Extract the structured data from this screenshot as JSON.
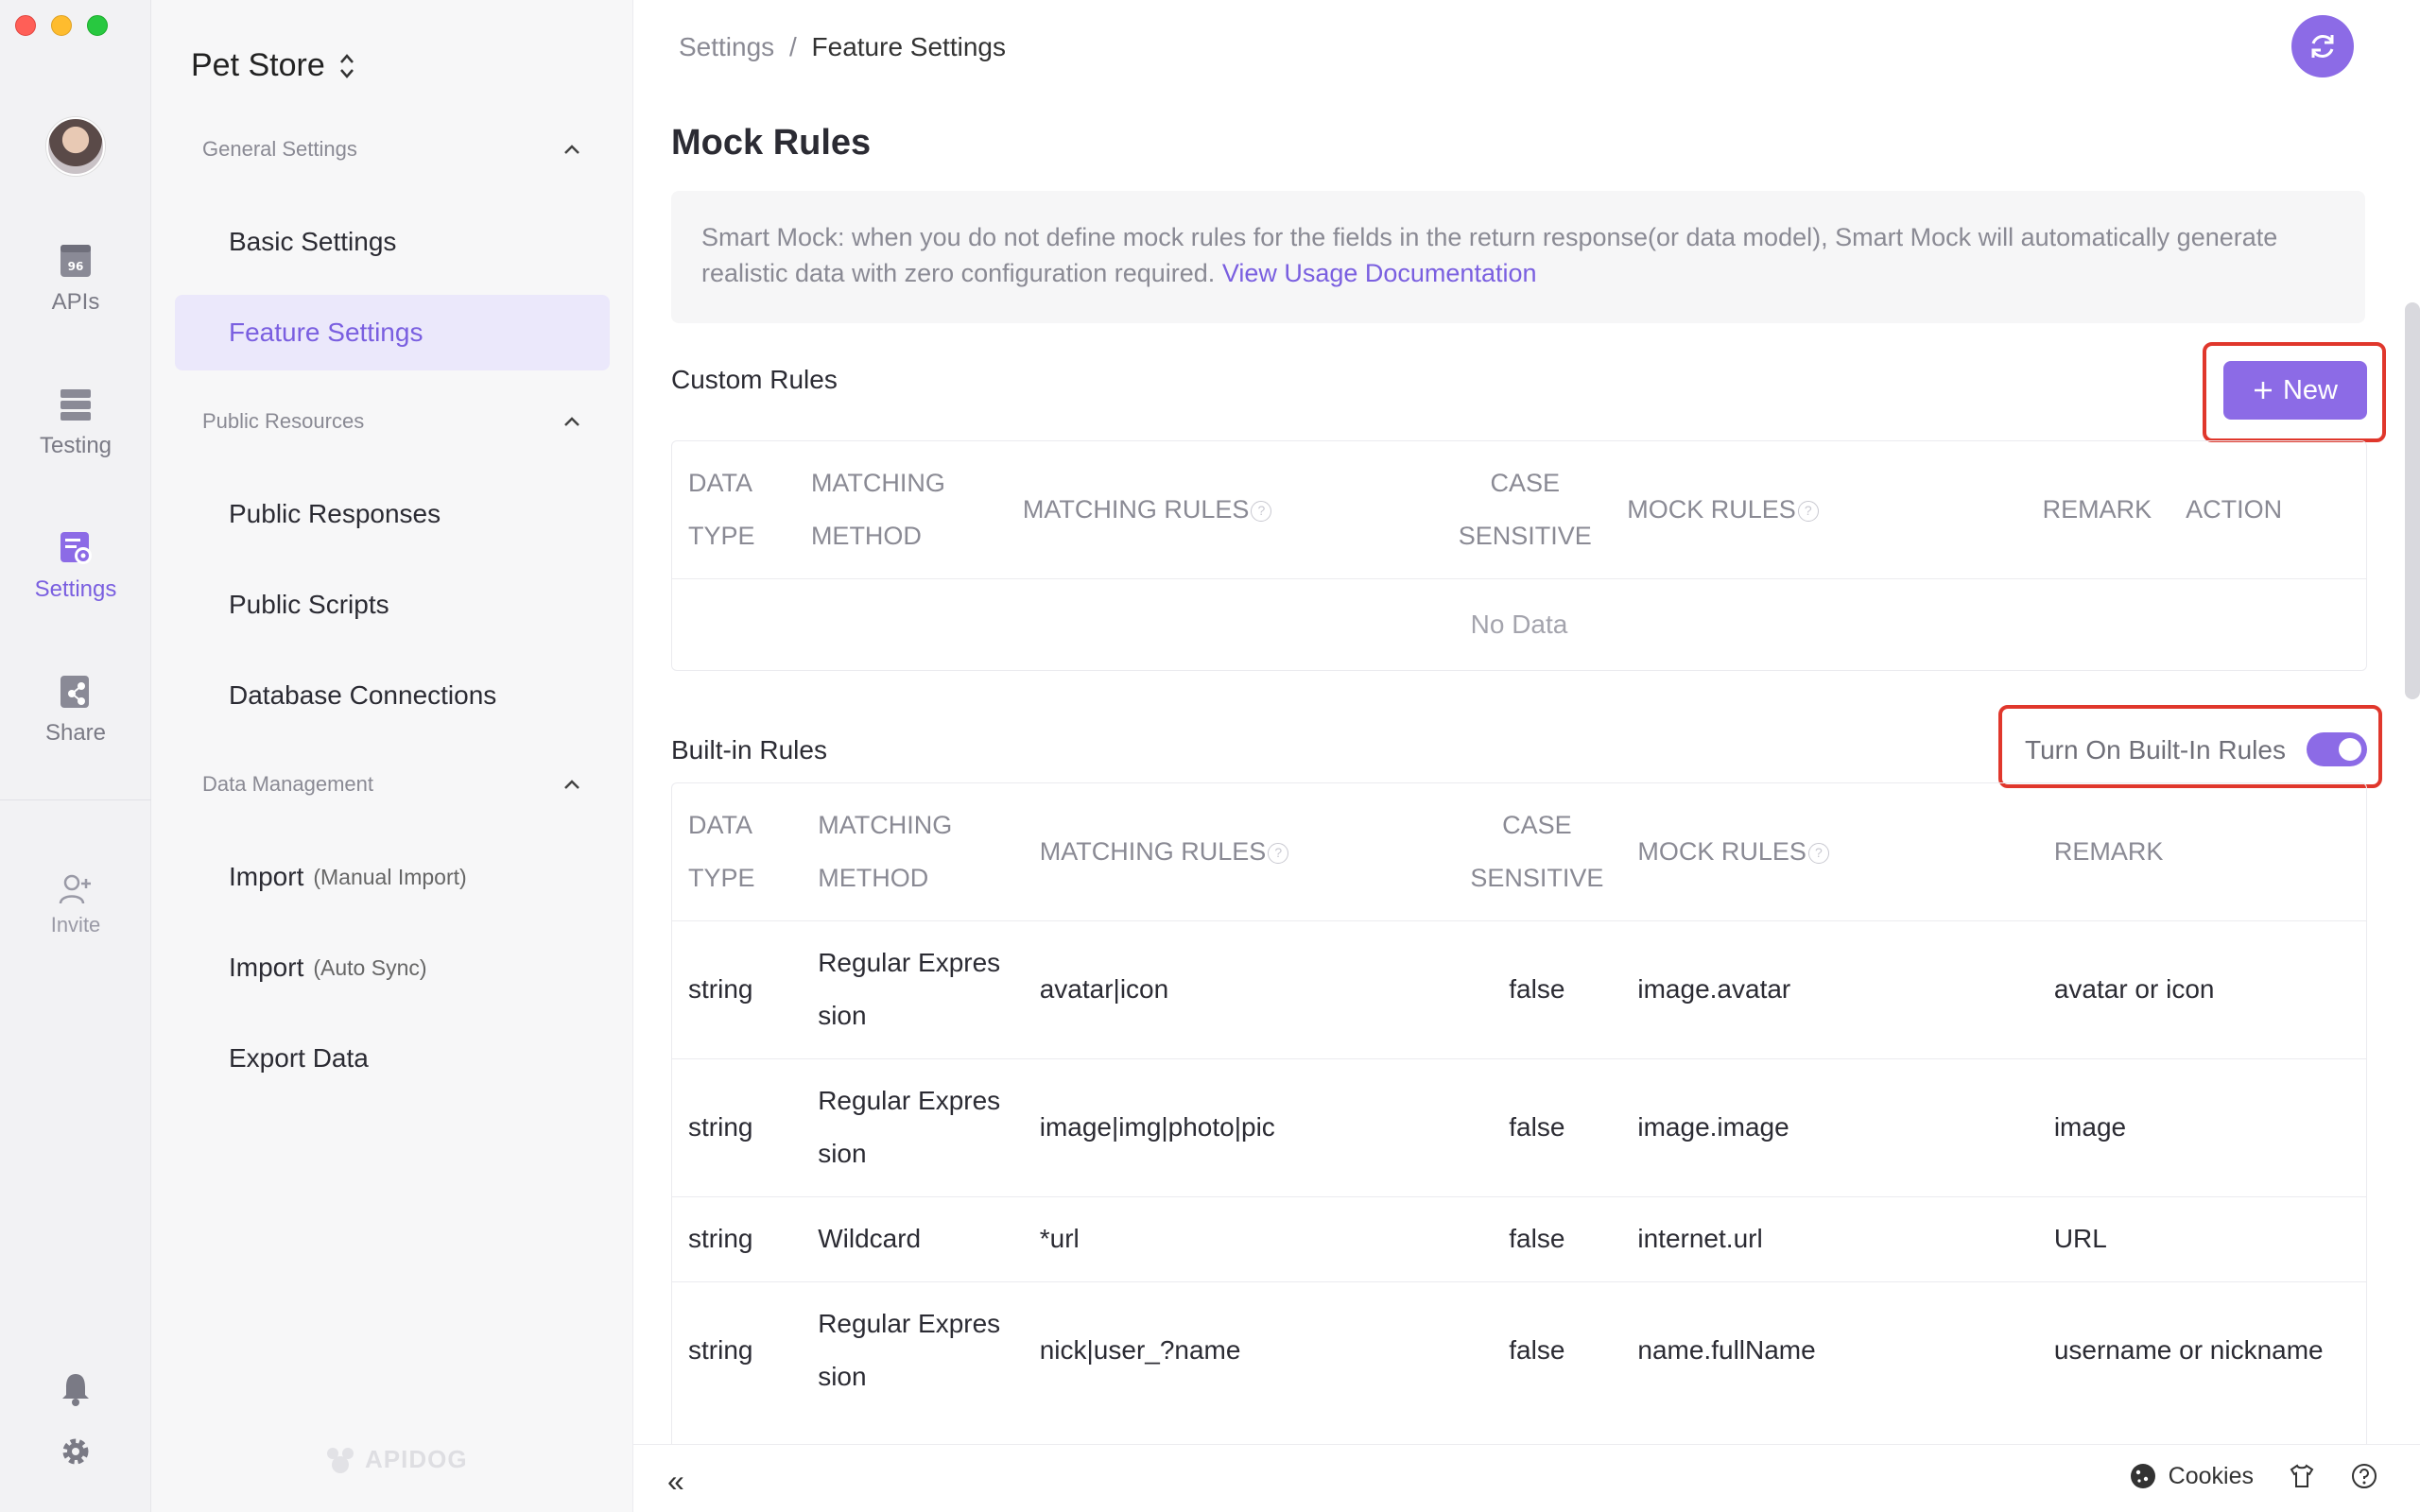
{
  "rail": {
    "items": [
      {
        "label": "APIs",
        "icon": "api-doc-icon"
      },
      {
        "label": "Testing",
        "icon": "testing-icon"
      },
      {
        "label": "Settings",
        "icon": "settings-doc-icon",
        "active": true
      },
      {
        "label": "Share",
        "icon": "share-icon"
      }
    ],
    "invite": "Invite"
  },
  "sidebar": {
    "project": "Pet Store",
    "groups": [
      {
        "label": "General Settings",
        "items": [
          "Basic Settings",
          "Feature Settings"
        ]
      },
      {
        "label": "Public Resources",
        "items": [
          "Public Responses",
          "Public Scripts",
          "Database Connections"
        ]
      },
      {
        "label": "Data Management",
        "items": [
          {
            "label": "Import",
            "sub": "(Manual Import)"
          },
          {
            "label": "Import",
            "sub": "(Auto Sync)"
          },
          {
            "label": "Export Data"
          }
        ]
      }
    ],
    "brand": "APIDOG"
  },
  "main": {
    "breadcrumb": {
      "root": "Settings",
      "sep": "/",
      "current": "Feature Settings"
    },
    "title": "Mock Rules",
    "info_text": "Smart Mock: when you do not define mock rules for the fields in the return response(or data model), Smart Mock will automatically generate realistic data with zero configuration required.",
    "info_link": "View Usage Documentation",
    "custom": {
      "label": "Custom Rules",
      "new_button": "New",
      "headers": {
        "data": "DATA",
        "type": "TYPE",
        "matching": "MATCHING",
        "method": "METHOD",
        "matching_rules": "MATCHING RULES",
        "case": "CASE",
        "sensitive": "SENSITIVE",
        "mock_rules": "MOCK RULES",
        "remark": "REMARK",
        "action": "ACTION"
      },
      "empty": "No Data"
    },
    "builtin": {
      "label": "Built-in Rules",
      "toggle_label": "Turn On Built-In Rules",
      "toggle_on": true,
      "headers": {
        "data": "DATA",
        "type": "TYPE",
        "matching": "MATCHING",
        "method": "METHOD",
        "matching_rules": "MATCHING RULES",
        "case": "CASE",
        "sensitive": "SENSITIVE",
        "mock_rules": "MOCK RULES",
        "remark": "REMARK"
      },
      "rows": [
        {
          "type": "string",
          "method1": "Regular Expres",
          "method2": "sion",
          "rule": "avatar|icon",
          "case": "false",
          "mock": "image.avatar",
          "remark": "avatar or icon"
        },
        {
          "type": "string",
          "method1": "Regular Expres",
          "method2": "sion",
          "rule": "image|img|photo|pic",
          "case": "false",
          "mock": "image.image",
          "remark": "image"
        },
        {
          "type": "string",
          "method1": "Wildcard",
          "method2": "",
          "rule": "*url",
          "case": "false",
          "mock": "internet.url",
          "remark": "URL"
        },
        {
          "type": "string",
          "method1": "Regular Expres",
          "method2": "sion",
          "rule": "nick|user_?name",
          "case": "false",
          "mock": "name.fullName",
          "remark": "username or nickname"
        }
      ]
    }
  },
  "footer": {
    "collapse": "«",
    "cookies": "Cookies"
  },
  "colors": {
    "accent": "#8c6be6",
    "highlight": "#e0372c"
  }
}
